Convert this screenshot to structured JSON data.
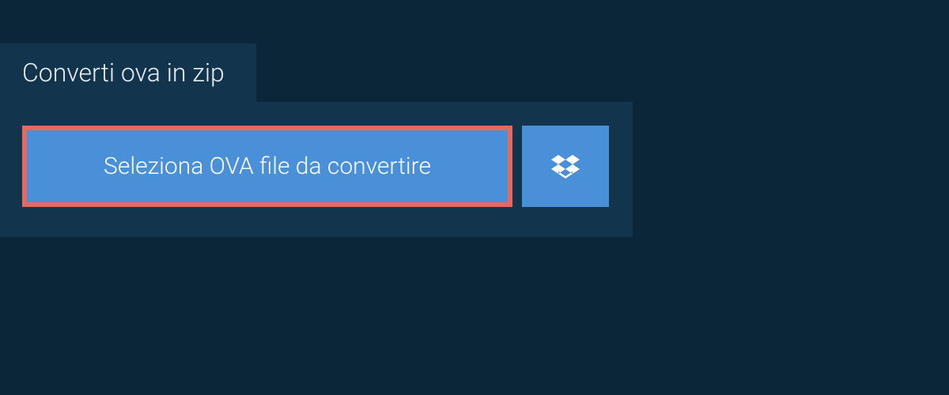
{
  "tab": {
    "label": "Converti ova in zip"
  },
  "buttons": {
    "select_file_label": "Seleziona OVA file da convertire"
  },
  "colors": {
    "background": "#0b2639",
    "panel": "#12344d",
    "button": "#4a90d9",
    "highlight_border": "#e36a5c",
    "text": "#ffffff"
  }
}
